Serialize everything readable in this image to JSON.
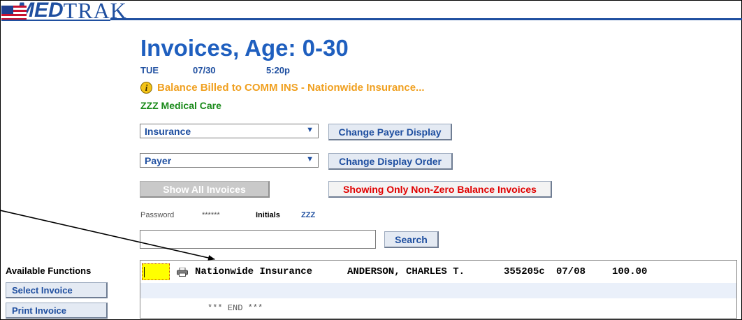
{
  "logo": {
    "med": "MED",
    "trak": "TRAK"
  },
  "page": {
    "title": "Invoices, Age: 0-30",
    "day": "TUE",
    "date": "07/30",
    "time": "5:20p",
    "alert": "Balance Billed to COMM INS - Nationwide Insurance...",
    "clinic": "ZZZ Medical Care"
  },
  "controls": {
    "display_select": "Insurance",
    "change_payer_display": "Change Payer Display",
    "order_select": "Payer",
    "change_display_order": "Change Display Order",
    "show_all": "Show All Invoices",
    "showing_nonzero": "Showing Only Non-Zero Balance Invoices"
  },
  "credentials": {
    "password_label": "Password",
    "password_value": "******",
    "initials_label": "Initials",
    "initials_value": "ZZZ"
  },
  "search": {
    "button": "Search",
    "value": ""
  },
  "functions": {
    "title": "Available Functions",
    "items": [
      "Select Invoice",
      "Print Invoice"
    ]
  },
  "invoices": {
    "rows": [
      {
        "payer": "Nationwide Insurance",
        "patient": "ANDERSON, CHARLES T.",
        "invoice": "355205c",
        "date": "07/08",
        "amount": "100.00"
      }
    ],
    "end_marker": "*** END ***"
  },
  "colors": {
    "brand_blue": "#1f5fbf",
    "alert_orange": "#f0a020",
    "clinic_green": "#1a8a1a",
    "warning_red": "#e00000",
    "selection_yellow": "#ffff00"
  }
}
